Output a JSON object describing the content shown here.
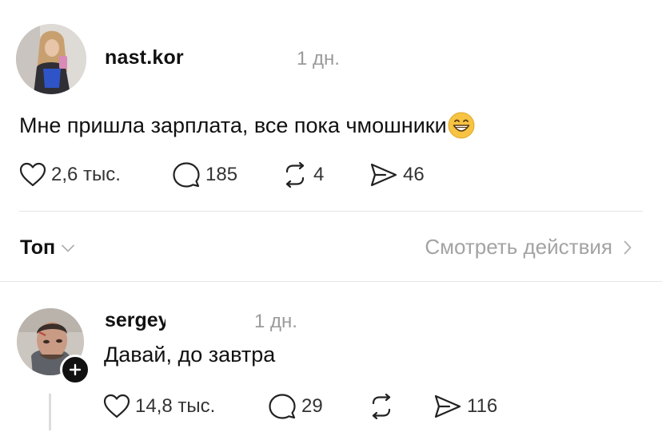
{
  "post": {
    "username": "nast.kor",
    "time": "1 дн.",
    "text": "Мне пришла зарплата, все пока чмошники",
    "emoji": "grinning-face-emoji",
    "likes": "2,6 тыс.",
    "comments": "185",
    "reposts": "4",
    "shares": "46"
  },
  "sort": {
    "label": "Топ",
    "view_activity": "Смотреть действия"
  },
  "reply": {
    "username": "sergey",
    "time": "1 дн.",
    "text": "Давай, до завтра",
    "likes": "14,8 тыс.",
    "comments": "29",
    "reposts": "",
    "shares": "116"
  },
  "colors": {
    "text": "#111111",
    "muted": "#9a9a9a",
    "divider": "#e3e3e3",
    "emoji_yellow": "#f6c343"
  }
}
